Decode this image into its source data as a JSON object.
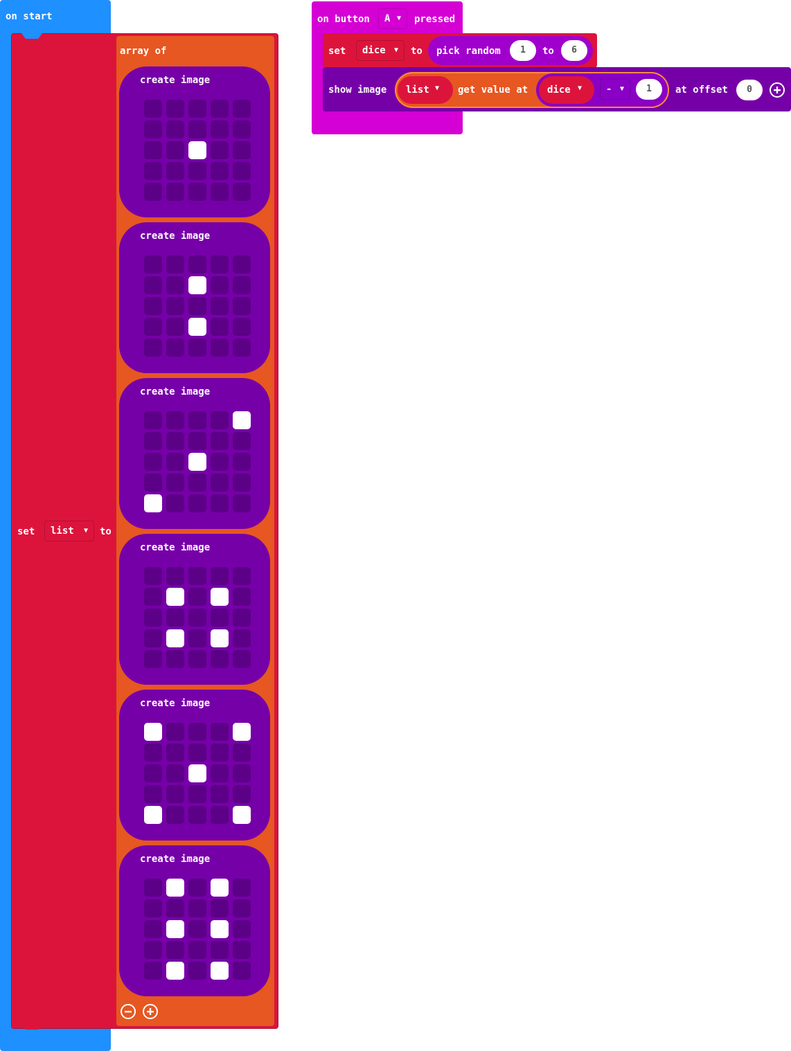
{
  "on_start": {
    "title": "on start",
    "set_block": {
      "set_label": "set",
      "variable": "list",
      "to_label": "to"
    },
    "array_block": {
      "label": "array of",
      "images": [
        {
          "label": "create image",
          "pixels": [
            [
              0,
              0,
              0,
              0,
              0
            ],
            [
              0,
              0,
              0,
              0,
              0
            ],
            [
              0,
              0,
              1,
              0,
              0
            ],
            [
              0,
              0,
              0,
              0,
              0
            ],
            [
              0,
              0,
              0,
              0,
              0
            ]
          ]
        },
        {
          "label": "create image",
          "pixels": [
            [
              0,
              0,
              0,
              0,
              0
            ],
            [
              0,
              0,
              1,
              0,
              0
            ],
            [
              0,
              0,
              0,
              0,
              0
            ],
            [
              0,
              0,
              1,
              0,
              0
            ],
            [
              0,
              0,
              0,
              0,
              0
            ]
          ]
        },
        {
          "label": "create image",
          "pixels": [
            [
              0,
              0,
              0,
              0,
              1
            ],
            [
              0,
              0,
              0,
              0,
              0
            ],
            [
              0,
              0,
              1,
              0,
              0
            ],
            [
              0,
              0,
              0,
              0,
              0
            ],
            [
              1,
              0,
              0,
              0,
              0
            ]
          ]
        },
        {
          "label": "create image",
          "pixels": [
            [
              0,
              0,
              0,
              0,
              0
            ],
            [
              0,
              1,
              0,
              1,
              0
            ],
            [
              0,
              0,
              0,
              0,
              0
            ],
            [
              0,
              1,
              0,
              1,
              0
            ],
            [
              0,
              0,
              0,
              0,
              0
            ]
          ]
        },
        {
          "label": "create image",
          "pixels": [
            [
              1,
              0,
              0,
              0,
              1
            ],
            [
              0,
              0,
              0,
              0,
              0
            ],
            [
              0,
              0,
              1,
              0,
              0
            ],
            [
              0,
              0,
              0,
              0,
              0
            ],
            [
              1,
              0,
              0,
              0,
              1
            ]
          ]
        },
        {
          "label": "create image",
          "pixels": [
            [
              0,
              1,
              0,
              1,
              0
            ],
            [
              0,
              0,
              0,
              0,
              0
            ],
            [
              0,
              1,
              0,
              1,
              0
            ],
            [
              0,
              0,
              0,
              0,
              0
            ],
            [
              0,
              1,
              0,
              1,
              0
            ]
          ]
        }
      ]
    }
  },
  "on_button": {
    "on_label": "on button",
    "button": "A",
    "pressed_label": "pressed",
    "set_dice": {
      "set_label": "set",
      "variable": "dice",
      "to_label": "to",
      "pick_random_label": "pick random",
      "from": "1",
      "to2_label": "to",
      "to_value": "6"
    },
    "show_image": {
      "label": "show image",
      "list_var": "list",
      "get_value_label": "get value at",
      "dice_var": "dice",
      "operator": "-",
      "operand": "1",
      "offset_label": "at offset",
      "offset_value": "0"
    }
  },
  "colors": {
    "events_blue": "#1e90ff",
    "variables_red": "#dc143c",
    "arrays_orange": "#e65722",
    "images_purple": "#7600a8",
    "input_magenta": "#d400d4"
  }
}
